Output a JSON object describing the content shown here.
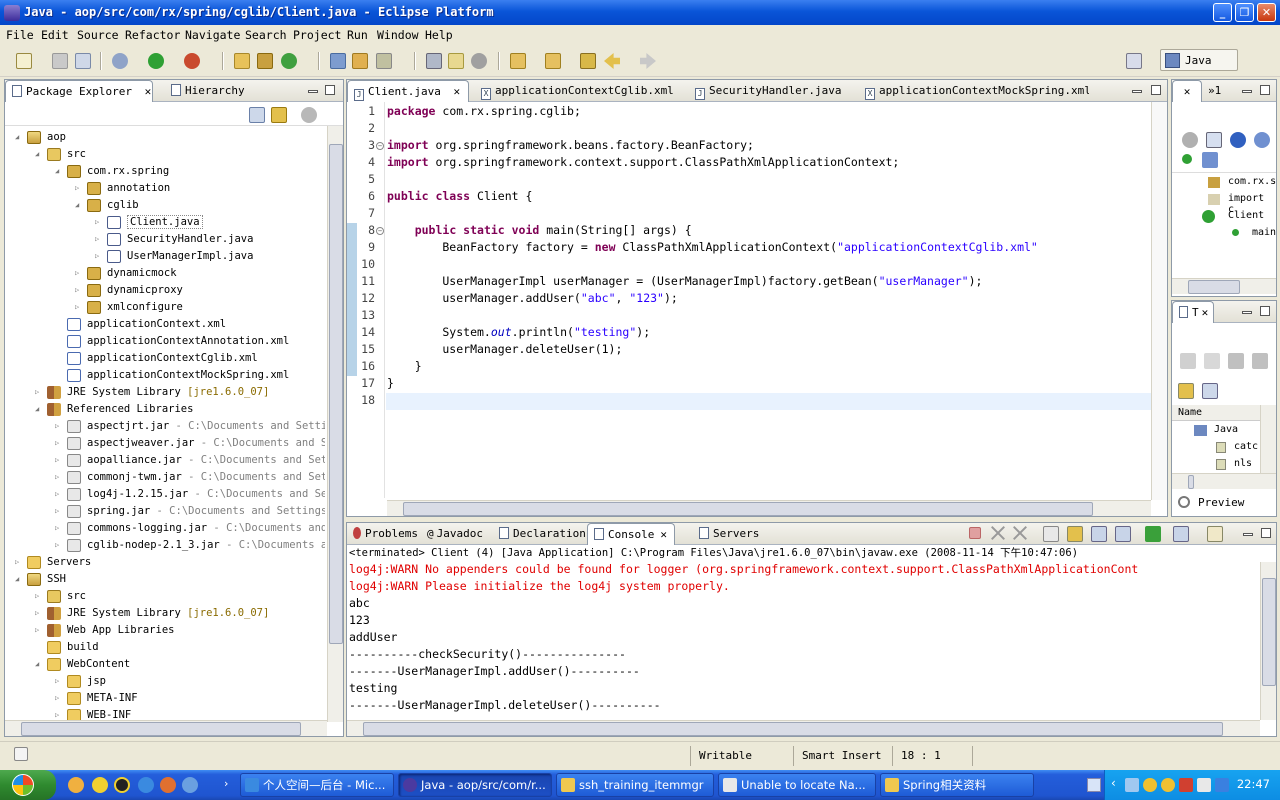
{
  "window": {
    "title": "Java - aop/src/com/rx/spring/cglib/Client.java - Eclipse Platform"
  },
  "menu": [
    "File",
    "Edit",
    "Source",
    "Refactor",
    "Navigate",
    "Search",
    "Project",
    "Run",
    "Window",
    "Help"
  ],
  "perspective": {
    "label": "Java"
  },
  "left_pane": {
    "tabs": [
      "Package Explorer",
      "Hierarchy"
    ],
    "tree": [
      {
        "label": "aop",
        "indent": 1,
        "icon": "project",
        "open": true
      },
      {
        "label": "src",
        "indent": 2,
        "icon": "srcfolder",
        "open": true
      },
      {
        "label": "com.rx.spring",
        "indent": 3,
        "icon": "package",
        "open": true
      },
      {
        "label": "annotation",
        "indent": 4,
        "icon": "package",
        "open": false
      },
      {
        "label": "cglib",
        "indent": 4,
        "icon": "package",
        "open": true
      },
      {
        "label": "Client.java",
        "indent": 5,
        "icon": "java",
        "open": false,
        "selected": true
      },
      {
        "label": "SecurityHandler.java",
        "indent": 5,
        "icon": "java",
        "open": false
      },
      {
        "label": "UserManagerImpl.java",
        "indent": 5,
        "icon": "java",
        "open": false
      },
      {
        "label": "dynamicmock",
        "indent": 4,
        "icon": "package",
        "open": false
      },
      {
        "label": "dynamicproxy",
        "indent": 4,
        "icon": "package",
        "open": false
      },
      {
        "label": "xmlconfigure",
        "indent": 4,
        "icon": "package",
        "open": false
      },
      {
        "label": "applicationContext.xml",
        "indent": 3,
        "icon": "xml",
        "leaf": true
      },
      {
        "label": "applicationContextAnnotation.xml",
        "indent": 3,
        "icon": "xml",
        "leaf": true
      },
      {
        "label": "applicationContextCglib.xml",
        "indent": 3,
        "icon": "xml",
        "leaf": true
      },
      {
        "label": "applicationContextMockSpring.xml",
        "indent": 3,
        "icon": "xml",
        "leaf": true
      },
      {
        "label": "JRE System Library",
        "deco": "[jre1.6.0_07]",
        "indent": 2,
        "icon": "library",
        "open": false
      },
      {
        "label": "Referenced Libraries",
        "indent": 2,
        "icon": "library",
        "open": true
      },
      {
        "label": "aspectjrt.jar",
        "deco": " - C:\\Documents and Settin",
        "indent": 3,
        "icon": "jar",
        "open": false
      },
      {
        "label": "aspectjweaver.jar",
        "deco": " - C:\\Documents and Se",
        "indent": 3,
        "icon": "jar",
        "open": false
      },
      {
        "label": "aopalliance.jar",
        "deco": " - C:\\Documents and Sett",
        "indent": 3,
        "icon": "jar",
        "open": false
      },
      {
        "label": "commonj-twm.jar",
        "deco": " - C:\\Documents and Sett",
        "indent": 3,
        "icon": "jar",
        "open": false
      },
      {
        "label": "log4j-1.2.15.jar",
        "deco": " - C:\\Documents and Set",
        "indent": 3,
        "icon": "jar",
        "open": false
      },
      {
        "label": "spring.jar",
        "deco": " - C:\\Documents and Settings\\",
        "indent": 3,
        "icon": "jar",
        "open": false
      },
      {
        "label": "commons-logging.jar",
        "deco": " - C:\\Documents and",
        "indent": 3,
        "icon": "jar",
        "open": false
      },
      {
        "label": "cglib-nodep-2.1_3.jar",
        "deco": " - C:\\Documents an",
        "indent": 3,
        "icon": "jar",
        "open": false
      },
      {
        "label": "Servers",
        "indent": 1,
        "icon": "folder",
        "open": false
      },
      {
        "label": "SSH",
        "indent": 1,
        "icon": "project",
        "open": true
      },
      {
        "label": "src",
        "indent": 2,
        "icon": "srcfolder",
        "open": false
      },
      {
        "label": "JRE System Library",
        "deco": "[jre1.6.0_07]",
        "indent": 2,
        "icon": "library",
        "open": false
      },
      {
        "label": "Web App Libraries",
        "indent": 2,
        "icon": "library",
        "open": false
      },
      {
        "label": "build",
        "indent": 2,
        "icon": "folder",
        "leaf": true
      },
      {
        "label": "WebContent",
        "indent": 2,
        "icon": "folder",
        "open": true
      },
      {
        "label": "jsp",
        "indent": 3,
        "icon": "folder",
        "open": false
      },
      {
        "label": "META-INF",
        "indent": 3,
        "icon": "folder",
        "open": false
      },
      {
        "label": "WEB-INF",
        "indent": 3,
        "icon": "folder",
        "open": false
      }
    ]
  },
  "editor": {
    "tabs": [
      "Client.java",
      "applicationContextCglib.xml",
      "SecurityHandler.java",
      "applicationContextMockSpring.xml"
    ],
    "lines": [
      [
        [
          "kw",
          "package"
        ],
        [
          "t",
          " com.rx.spring.cglib;"
        ]
      ],
      [],
      [
        [
          "kw",
          "import"
        ],
        [
          "t",
          " org.springframework.beans.factory.BeanFactory;"
        ]
      ],
      [
        [
          "kw",
          "import"
        ],
        [
          "t",
          " org.springframework.context.support.ClassPathXmlApplicationContext;"
        ]
      ],
      [],
      [
        [
          "kw",
          "public class"
        ],
        [
          "t",
          " Client {"
        ]
      ],
      [],
      [
        [
          "t",
          "    "
        ],
        [
          "kw",
          "public static void"
        ],
        [
          "t",
          " main(String[] args) {"
        ]
      ],
      [
        [
          "t",
          "        BeanFactory factory = "
        ],
        [
          "kw",
          "new"
        ],
        [
          "t",
          " ClassPathXmlApplicationContext("
        ],
        [
          "str",
          "\"applicationContextCglib.xml\""
        ]
      ],
      [],
      [
        [
          "t",
          "        UserManagerImpl userManager = (UserManagerImpl)factory.getBean("
        ],
        [
          "str",
          "\"userManager\""
        ],
        [
          "t",
          ");"
        ]
      ],
      [
        [
          "t",
          "        userManager.addUser("
        ],
        [
          "str",
          "\"abc\""
        ],
        [
          "t",
          ", "
        ],
        [
          "str",
          "\"123\""
        ],
        [
          "t",
          ");"
        ]
      ],
      [],
      [
        [
          "t",
          "        System."
        ],
        [
          "ital",
          "out"
        ],
        [
          "t",
          ".println("
        ],
        [
          "str",
          "\"testing\""
        ],
        [
          "t",
          ");"
        ]
      ],
      [
        [
          "t",
          "        userManager.deleteUser(1);"
        ]
      ],
      [
        [
          "t",
          "    }"
        ]
      ],
      [
        [
          "t",
          "}"
        ]
      ],
      []
    ]
  },
  "outline": {
    "items": [
      "com.rx.s",
      "import c",
      "Client",
      "main"
    ]
  },
  "tasks_pane": {
    "tab": "T",
    "column": "Name",
    "items": [
      "Java",
      "catc",
      "nls"
    ],
    "preview": "Preview"
  },
  "console": {
    "tabs": [
      "Problems",
      "Javadoc",
      "Declaration",
      "Console",
      "Servers"
    ],
    "header": "<terminated> Client (4) [Java Application] C:\\Program Files\\Java\\jre1.6.0_07\\bin\\javaw.exe (2008-11-14 下午10:47:06)",
    "lines": [
      {
        "text": "log4j:WARN No appenders could be found for logger (org.springframework.context.support.ClassPathXmlApplicationCont",
        "err": true
      },
      {
        "text": "log4j:WARN Please initialize the log4j system properly.",
        "err": true
      },
      {
        "text": "abc"
      },
      {
        "text": "123"
      },
      {
        "text": "addUser"
      },
      {
        "text": "----------checkSecurity()---------------"
      },
      {
        "text": "-------UserManagerImpl.addUser()----------"
      },
      {
        "text": "testing"
      },
      {
        "text": "-------UserManagerImpl.deleteUser()----------"
      }
    ]
  },
  "status": {
    "writable": "Writable",
    "insert": "Smart Insert",
    "position": "18 : 1"
  },
  "taskbar": {
    "tasks": [
      "个人空间—后台 - Mic...",
      "Java - aop/src/com/r...",
      "ssh_training_itemmgr",
      "Unable to locate Na...",
      "Spring相关资料"
    ],
    "clock": "22:47"
  },
  "colors": {
    "titlebar": "#0a55d8",
    "keyword": "#7f0055",
    "string": "#2a00ff",
    "console_error": "#e00000"
  }
}
